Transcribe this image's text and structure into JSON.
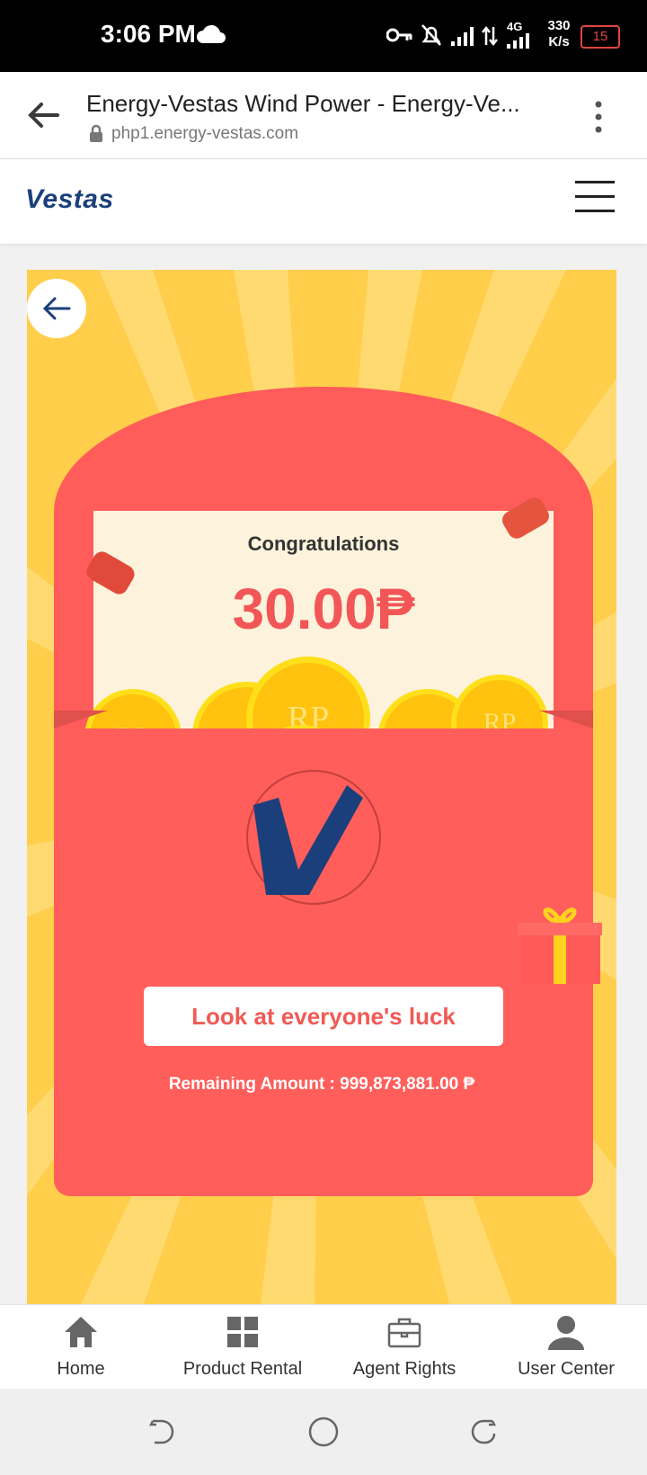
{
  "status_bar": {
    "time": "3:06 PM",
    "network": "4G",
    "speed_value": "330",
    "speed_unit": "K/s",
    "battery": "15"
  },
  "browser": {
    "page_title": "Energy-Vestas Wind Power - Energy-Ve...",
    "url": "php1.energy-vestas.com"
  },
  "site": {
    "brand": "Vestas"
  },
  "envelope": {
    "congrats": "Congratulations",
    "amount": "30.00₱",
    "button_label": "Look at everyone's luck",
    "remaining": "Remaining Amount : 999,873,881.00 ₱",
    "coin_text": "RP"
  },
  "bottom_nav": {
    "items": [
      {
        "label": "Home",
        "icon": "home-icon"
      },
      {
        "label": "Product Rental",
        "icon": "grid-icon"
      },
      {
        "label": "Agent Rights",
        "icon": "briefcase-icon"
      },
      {
        "label": "User Center",
        "icon": "user-icon"
      }
    ]
  },
  "colors": {
    "envelope_red": "#ff5e5b",
    "scene_yellow": "#ffce4a",
    "amount_red": "#f25656",
    "brand_blue": "#1b3f7a"
  }
}
